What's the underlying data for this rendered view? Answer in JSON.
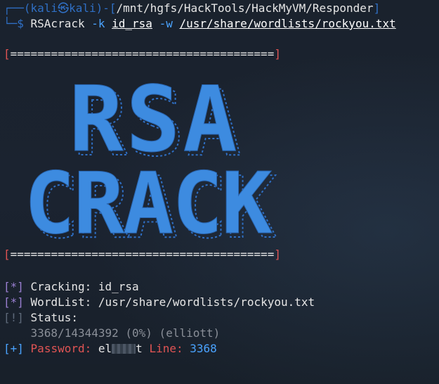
{
  "colors": {
    "background": "#1e2430",
    "accent_blue": "#2f6fc4",
    "banner_blue": "#3d8be0",
    "red": "#e05454",
    "purple": "#9a7fd1"
  },
  "prompt": {
    "box_top": "┌──(",
    "user": "kali",
    "at_symbol": "㉿",
    "host": "kali",
    "dir_open": ")-[",
    "cwd": "/mnt/hgfs/HackTools/HackMyVM/Responder",
    "dir_close": "]",
    "box_bottom": "└─$ ",
    "command": "RSAcrack",
    "flag_k": "-k",
    "key_file": "id_rsa",
    "flag_w": "-w",
    "wordlist": "/usr/share/wordlists/rockyou.txt"
  },
  "banner": {
    "separator_open": "[",
    "separator_bar": "=======================================",
    "separator_close": "]",
    "line1": "RSA",
    "line2": "CRACK"
  },
  "output": {
    "cracking_tag": "[*]",
    "cracking_label": "Cracking:",
    "cracking_value": "id_rsa",
    "wordlist_tag": "[*]",
    "wordlist_label": "WordList:",
    "wordlist_value": "/usr/share/wordlists/rockyou.txt",
    "status_tag": "[!]",
    "status_label": "Status:",
    "progress": "3368/14344392 (0%) (elliott)",
    "password_tag": "[+]",
    "password_label": "Password:",
    "password_prefix": "el",
    "password_suffix": "t",
    "line_label": "Line:",
    "line_value": "3368"
  }
}
